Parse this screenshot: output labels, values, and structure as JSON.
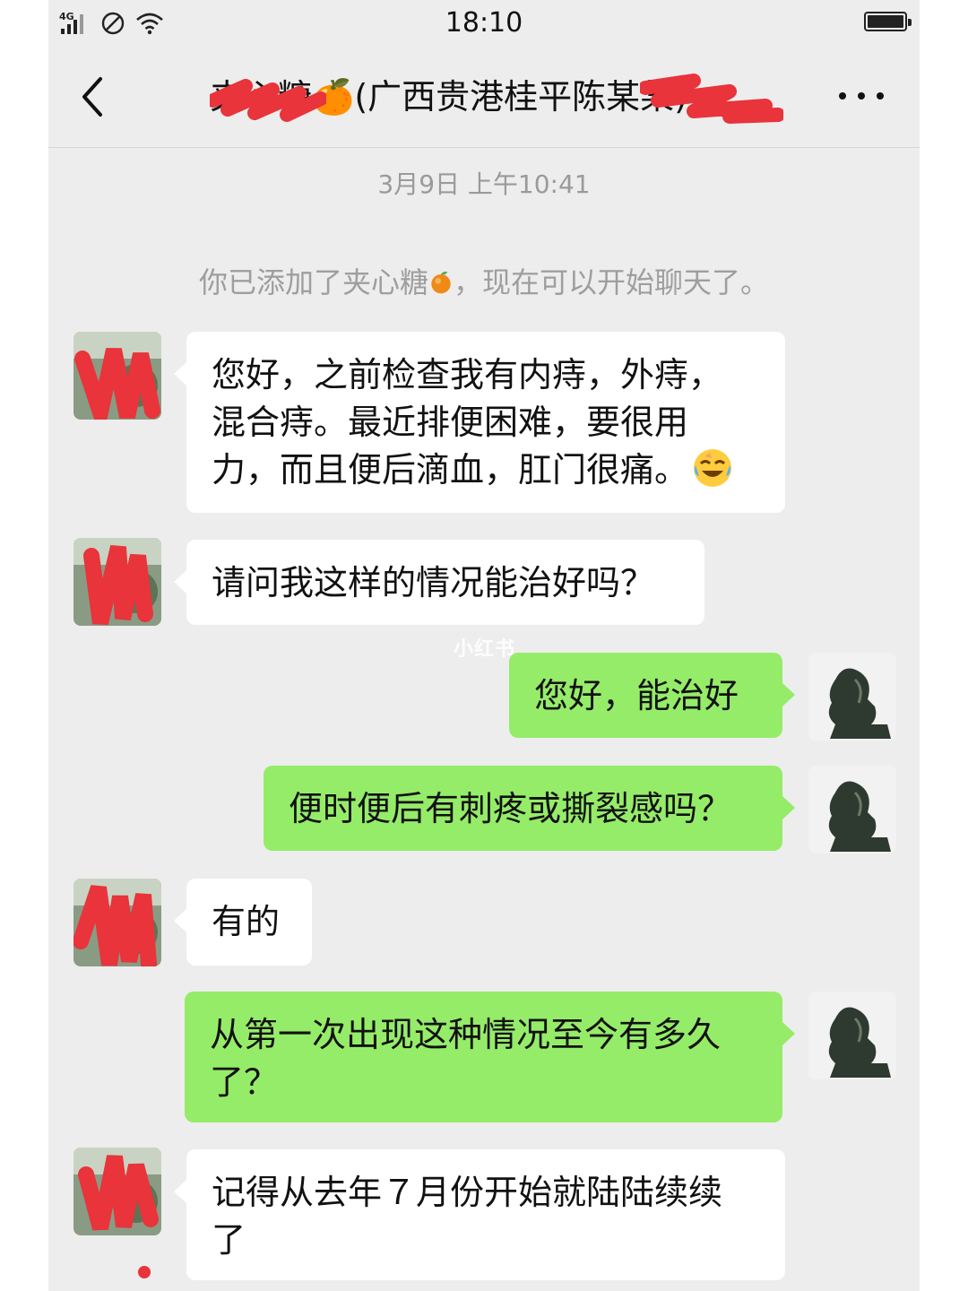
{
  "status_bar": {
    "network": "4G",
    "time": "18:10"
  },
  "nav": {
    "title": "夹心糖🍊(广西贵港桂平陈某某)",
    "back_icon": "chevron-left-icon",
    "more_icon": "more-dots-icon"
  },
  "chat": {
    "timestamp": "3月9日 上午10:41",
    "system_message_pre": "你已添加了夹心糖",
    "system_message_post": "，现在可以开始聊天了。",
    "messages": [
      {
        "side": "left",
        "lines": [
          "您好，之前检查我有内痔，外痔，",
          "混合痔。最近排便困难，要很用",
          "力，而且便后滴血，肛门很痛。"
        ],
        "emoji": "crying-laughing-emoji"
      },
      {
        "side": "left",
        "lines": [
          "请问我这样的情况能治好吗？"
        ]
      },
      {
        "side": "right",
        "lines": [
          "您好，能治好"
        ]
      },
      {
        "side": "right",
        "lines": [
          "便时便后有刺疼或撕裂感吗？"
        ]
      },
      {
        "side": "left",
        "lines": [
          "有的"
        ]
      },
      {
        "side": "right",
        "lines": [
          "从第一次出现这种情况至今有多久",
          "了？"
        ]
      },
      {
        "side": "left",
        "lines": [
          "记得从去年７月份开始就陆陆续续",
          "了"
        ]
      }
    ]
  },
  "watermark": "小红书",
  "colors": {
    "chat_background": "#ededed",
    "sent_bubble": "#95ec69",
    "received_bubble": "#ffffff",
    "redaction": "#e8343a"
  }
}
